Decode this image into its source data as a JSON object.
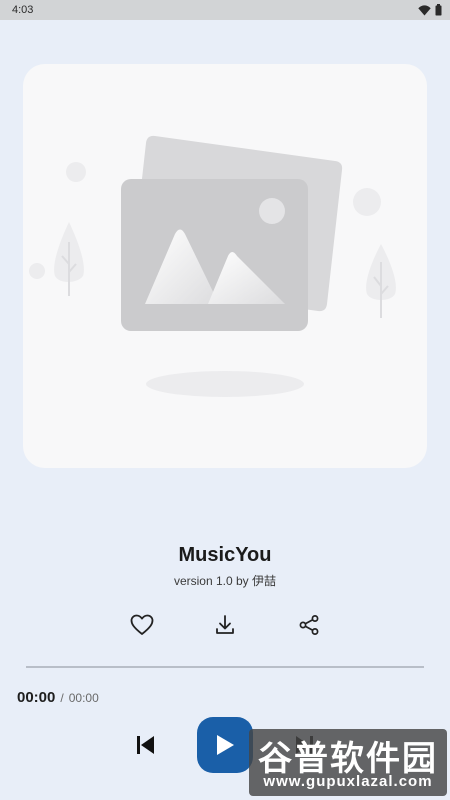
{
  "status_bar": {
    "time": "4:03",
    "icons": [
      "wifi-icon",
      "battery-icon"
    ]
  },
  "artwork": {
    "placeholder_icon": "image-placeholder-icon"
  },
  "track": {
    "title": "MusicYou",
    "subtitle": "version 1.0 by 伊喆"
  },
  "actions": [
    {
      "icon": "heart-icon",
      "label": "favorite"
    },
    {
      "icon": "download-icon",
      "label": "download"
    },
    {
      "icon": "share-icon",
      "label": "share"
    }
  ],
  "playback": {
    "current_time": "00:00",
    "separator": "/",
    "total_time": "00:00",
    "progress_fraction": 0,
    "state": "paused"
  },
  "controls": {
    "previous_icon": "skip-previous-icon",
    "play_icon": "play-icon",
    "next_icon": "skip-next-icon"
  },
  "watermark": {
    "text": "谷普软件园",
    "url": "www.gupuxlazal.com"
  },
  "colors": {
    "background": "#e8eef8",
    "accent": "#1a5fa8",
    "card": "#f8f8f9"
  }
}
